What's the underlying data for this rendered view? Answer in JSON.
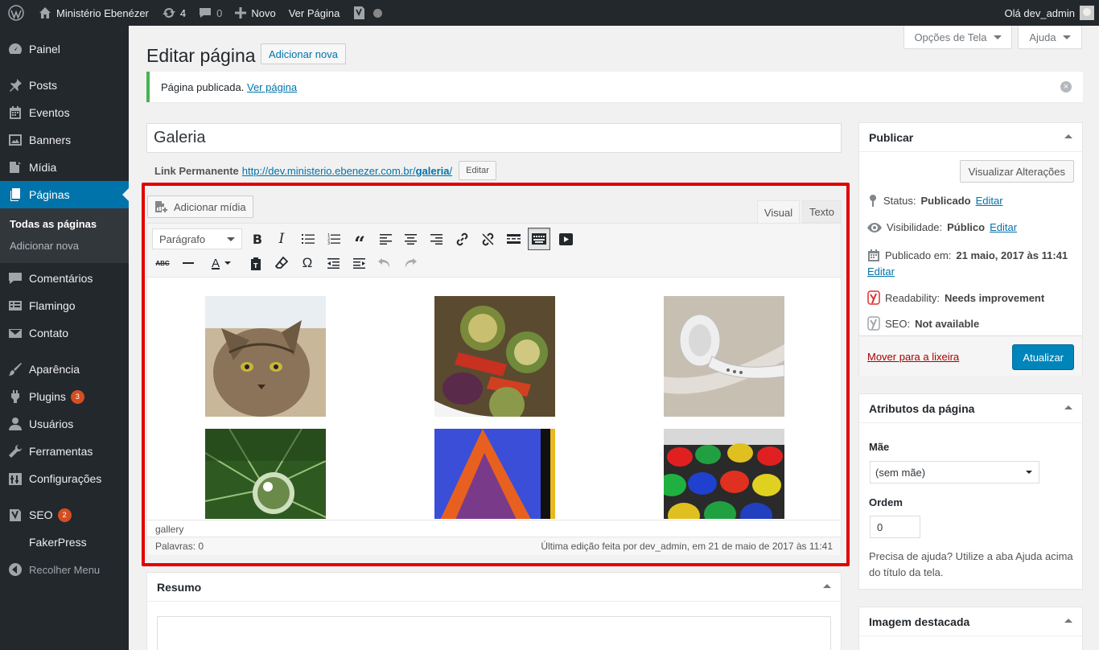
{
  "adminbar": {
    "site_name": "Ministério Ebenézer",
    "updates_count": "4",
    "comments_count": "0",
    "new_label": "Novo",
    "view_page": "Ver Página",
    "greeting": "Olá dev_admin"
  },
  "sidebar": {
    "items": [
      {
        "label": "Painel",
        "icon": "dashboard-icon"
      },
      {
        "label": "Posts",
        "icon": "pin-icon"
      },
      {
        "label": "Eventos",
        "icon": "calendar-icon"
      },
      {
        "label": "Banners",
        "icon": "image-icon"
      },
      {
        "label": "Mídia",
        "icon": "media-icon"
      },
      {
        "label": "Páginas",
        "icon": "pages-icon"
      },
      {
        "label": "Comentários",
        "icon": "comment-icon"
      },
      {
        "label": "Flamingo",
        "icon": "list-icon"
      },
      {
        "label": "Contato",
        "icon": "mail-icon"
      },
      {
        "label": "Aparência",
        "icon": "brush-icon"
      },
      {
        "label": "Plugins",
        "icon": "plugin-icon",
        "badge": "3"
      },
      {
        "label": "Usuários",
        "icon": "user-icon"
      },
      {
        "label": "Ferramentas",
        "icon": "wrench-icon"
      },
      {
        "label": "Configurações",
        "icon": "settings-icon"
      },
      {
        "label": "SEO",
        "icon": "yoast-icon",
        "badge": "2"
      },
      {
        "label": "FakerPress",
        "icon": "none"
      },
      {
        "label": "Recolher Menu",
        "icon": "collapse-icon"
      }
    ],
    "submenu": [
      "Todas as páginas",
      "Adicionar nova"
    ]
  },
  "screen_options": "Opções de Tela",
  "help": "Ajuda",
  "page": {
    "title": "Editar página",
    "add_new": "Adicionar nova",
    "notice_text": "Página publicada.",
    "notice_link": "Ver página",
    "post_title": "Galeria",
    "permalink_label": "Link Permanente",
    "permalink_base": "http://dev.ministerio.ebenezer.com.br/",
    "permalink_slug": "galeria",
    "permalink_end": "/",
    "edit_btn": "Editar"
  },
  "editor": {
    "add_media": "Adicionar mídia",
    "tab_visual": "Visual",
    "tab_text": "Texto",
    "format": "Parágrafo",
    "path": "gallery",
    "word_count": "Palavras: 0",
    "last_edit": "Última edição feita por dev_admin, em 21 de maio de 2017 às 11:41"
  },
  "excerpt": {
    "title": "Resumo"
  },
  "publish": {
    "title": "Publicar",
    "preview": "Visualizar Alterações",
    "status_label": "Status:",
    "status_value": "Publicado",
    "status_edit": "Editar",
    "visibility_label": "Visibilidade:",
    "visibility_value": "Público",
    "visibility_edit": "Editar",
    "published_label": "Publicado em:",
    "published_value": "21 maio, 2017 às 11:41",
    "published_edit": "Editar",
    "readability_label": "Readability:",
    "readability_value": "Needs improvement",
    "seo_label": "SEO:",
    "seo_value": "Not available",
    "trash": "Mover para a lixeira",
    "update": "Atualizar"
  },
  "attributes": {
    "title": "Atributos da página",
    "parent_label": "Mãe",
    "parent_value": "(sem mãe)",
    "order_label": "Ordem",
    "order_value": "0",
    "help_text": "Precisa de ajuda? Utilize a aba Ajuda acima do título da tela."
  },
  "featured": {
    "title": "Imagem destacada"
  }
}
